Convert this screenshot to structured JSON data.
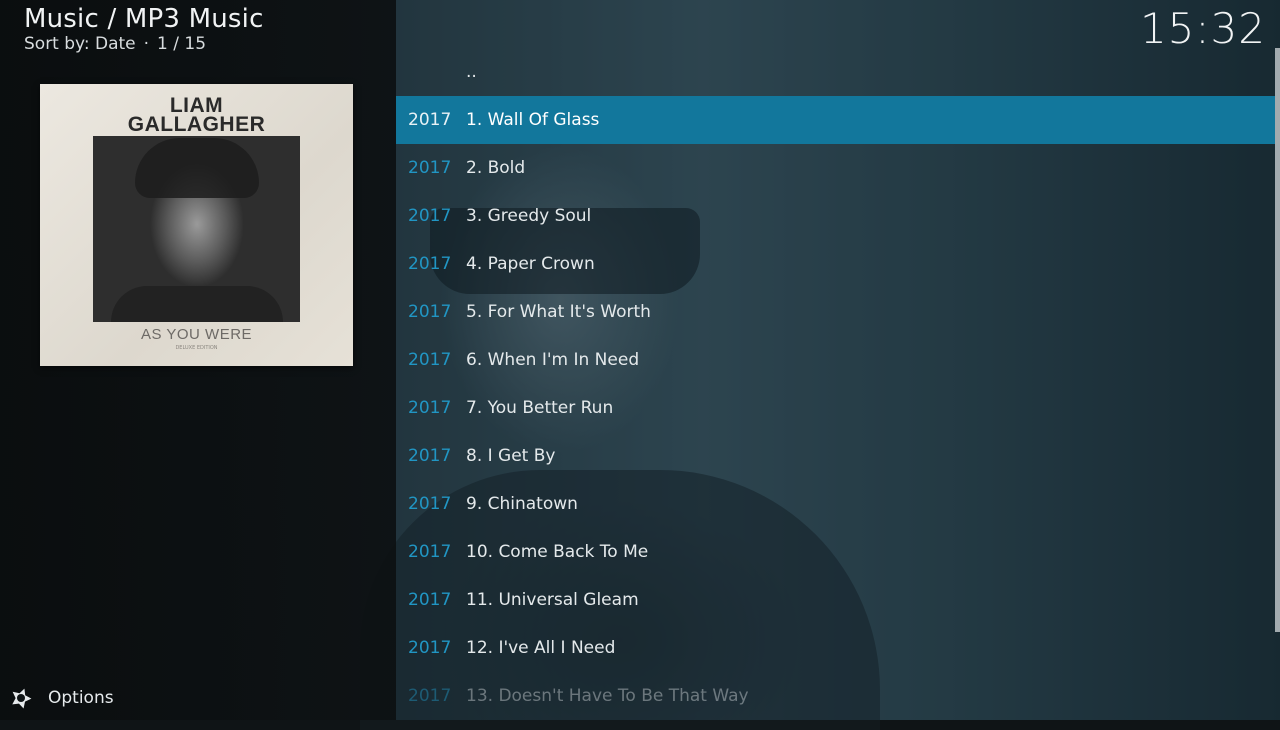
{
  "header": {
    "title": "Music / MP3 Music",
    "sort_label": "Sort by: Date",
    "separator": "·",
    "position": "1 / 15"
  },
  "clock": "15:32",
  "cover": {
    "artist_line1": "LIAM",
    "artist_line2": "GALLAGHER",
    "album": "AS YOU WERE",
    "album_sub": "DELUXE EDITION"
  },
  "list": {
    "parent_label": "..",
    "items": [
      {
        "year": "2017",
        "title": "1. Wall Of Glass"
      },
      {
        "year": "2017",
        "title": "2. Bold"
      },
      {
        "year": "2017",
        "title": "3. Greedy Soul"
      },
      {
        "year": "2017",
        "title": "4. Paper Crown"
      },
      {
        "year": "2017",
        "title": "5. For What It's Worth"
      },
      {
        "year": "2017",
        "title": "6. When I'm In Need"
      },
      {
        "year": "2017",
        "title": "7. You Better Run"
      },
      {
        "year": "2017",
        "title": "8. I Get By"
      },
      {
        "year": "2017",
        "title": "9. Chinatown"
      },
      {
        "year": "2017",
        "title": "10. Come Back To Me"
      },
      {
        "year": "2017",
        "title": "11. Universal Gleam"
      },
      {
        "year": "2017",
        "title": "12. I've All I Need"
      },
      {
        "year": "2017",
        "title": "13. Doesn't Have To Be That Way"
      }
    ],
    "selected_index": 0
  },
  "footer": {
    "options_label": "Options",
    "options_icon": "options-icon"
  },
  "colors": {
    "accent": "#12779c",
    "year": "#2196c4"
  }
}
